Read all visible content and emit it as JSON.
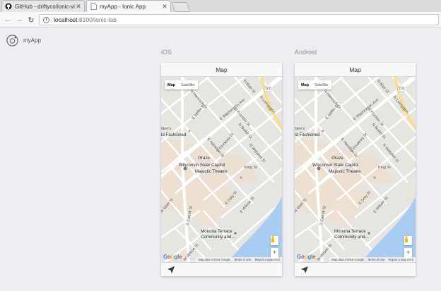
{
  "browser": {
    "tabs": [
      {
        "title": "GitHub - driftyco/ionic-vi",
        "icon": "github-icon",
        "active": false
      },
      {
        "title": "myApp - Ionic App",
        "icon": "page-icon",
        "active": true
      }
    ],
    "url_host": "localhost",
    "url_path": ":8100/ionic-lab"
  },
  "lab": {
    "app_name": "myApp",
    "platforms": [
      {
        "label": "iOS",
        "header_title": "Map",
        "map": {
          "type_map": "Map",
          "type_satellite": "Satellite",
          "google": [
            "G",
            "o",
            "o",
            "g",
            "l",
            "e"
          ],
          "attribution": [
            "Map data ©2016 Google",
            "Terms of Use",
            "Report a map error"
          ],
          "zoom_in": "+",
          "zoom_out": "−"
        }
      },
      {
        "label": "Android",
        "header_title": "Map",
        "map": {
          "type_map": "Map",
          "type_satellite": "Satellite",
          "google": [
            "G",
            "o",
            "o",
            "g",
            "l",
            "e"
          ],
          "attribution": [
            "Map data ©2016 Google",
            "Terms of Use",
            "Report a map error"
          ],
          "zoom_in": "+",
          "zoom_out": "−"
        }
      }
    ]
  },
  "map_labels": {
    "hancock_top": "N Hancock St",
    "hancock_top2": "E Hancock St",
    "blair": "N Blair St",
    "livingston": "N Livingston",
    "fashioned_prefix": "lden's",
    "old_fashioned": "ld Fashioned",
    "n_miflin": "E Mifflin St",
    "franklin": "N Franklin St",
    "washington": "E Washington Ave",
    "butler": "N Butler St",
    "hamilton": "E Hamilton St",
    "webster": "N Webster St",
    "pinckney": "S Pinckney St",
    "graze": "Graze",
    "capitol": "Wisconsin State Capitol",
    "majestic": "Majestic Theatre",
    "king": "King St",
    "doty": "E Doty St",
    "wilson": "E Wilson St",
    "main": "W Main St",
    "carroll": "S Carroll St",
    "monona1": "Monona Terrace",
    "monona2": "Community and...",
    "w_wilson": "W Wilson St",
    "route": "113"
  },
  "colors": {
    "tab_active": "#f6f7f8",
    "map_bg": "#e7e5e0",
    "road": "#ffffff",
    "highway": "#f7df8c",
    "water": "#a8cdf0",
    "park": "#eedfcf"
  }
}
